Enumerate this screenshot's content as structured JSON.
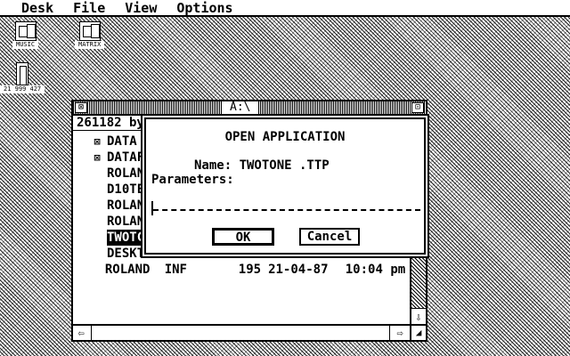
{
  "menubar": {
    "items": [
      "Desk",
      "File",
      "View",
      "Options"
    ]
  },
  "desktop": {
    "icons": [
      {
        "label": "MUSIC"
      },
      {
        "label": "MATRIX"
      }
    ],
    "trash_caption": "21 999 427"
  },
  "window": {
    "title": "A:\\",
    "info": "261182 by",
    "close_glyph": "⊠",
    "full_glyph": "⊡",
    "files": [
      {
        "icon": "⊠",
        "name": "DATA",
        "ext": "",
        "size": "",
        "date": "",
        "time": ""
      },
      {
        "icon": "⊠",
        "name": "DATAF",
        "ext": "",
        "size": "",
        "date": "",
        "time": ""
      },
      {
        "icon": "",
        "name": "ROLAN",
        "ext": "",
        "size": "",
        "date": "",
        "time": ""
      },
      {
        "icon": "",
        "name": "D10TE",
        "ext": "",
        "size": "",
        "date": "",
        "time": ""
      },
      {
        "icon": "",
        "name": "ROLAN",
        "ext": "",
        "size": "",
        "date": "",
        "time": ""
      },
      {
        "icon": "",
        "name": "ROLAN",
        "ext": "",
        "size": "",
        "date": "",
        "time": ""
      },
      {
        "icon": "",
        "name": "TWOTC",
        "ext": "",
        "size": "",
        "date": "",
        "time": "",
        "selected": true
      },
      {
        "icon": "",
        "name": "DESKT",
        "ext": "",
        "size": "",
        "date": "",
        "time": ""
      },
      {
        "icon": "",
        "name": "ROLAND",
        "ext": "INF",
        "size": "195",
        "date": "21-04-87",
        "time": "10:04 pm"
      }
    ],
    "scroll_up": "⇧",
    "scroll_down": "⇩",
    "scroll_left": "⇦",
    "scroll_right": "⇨",
    "sizer": "◢"
  },
  "dialog": {
    "title": "OPEN APPLICATION",
    "name_line": "Name: TWOTONE .TTP",
    "params_label": "Parameters:",
    "params_value": "",
    "ok_label": "OK",
    "cancel_label": "Cancel"
  }
}
